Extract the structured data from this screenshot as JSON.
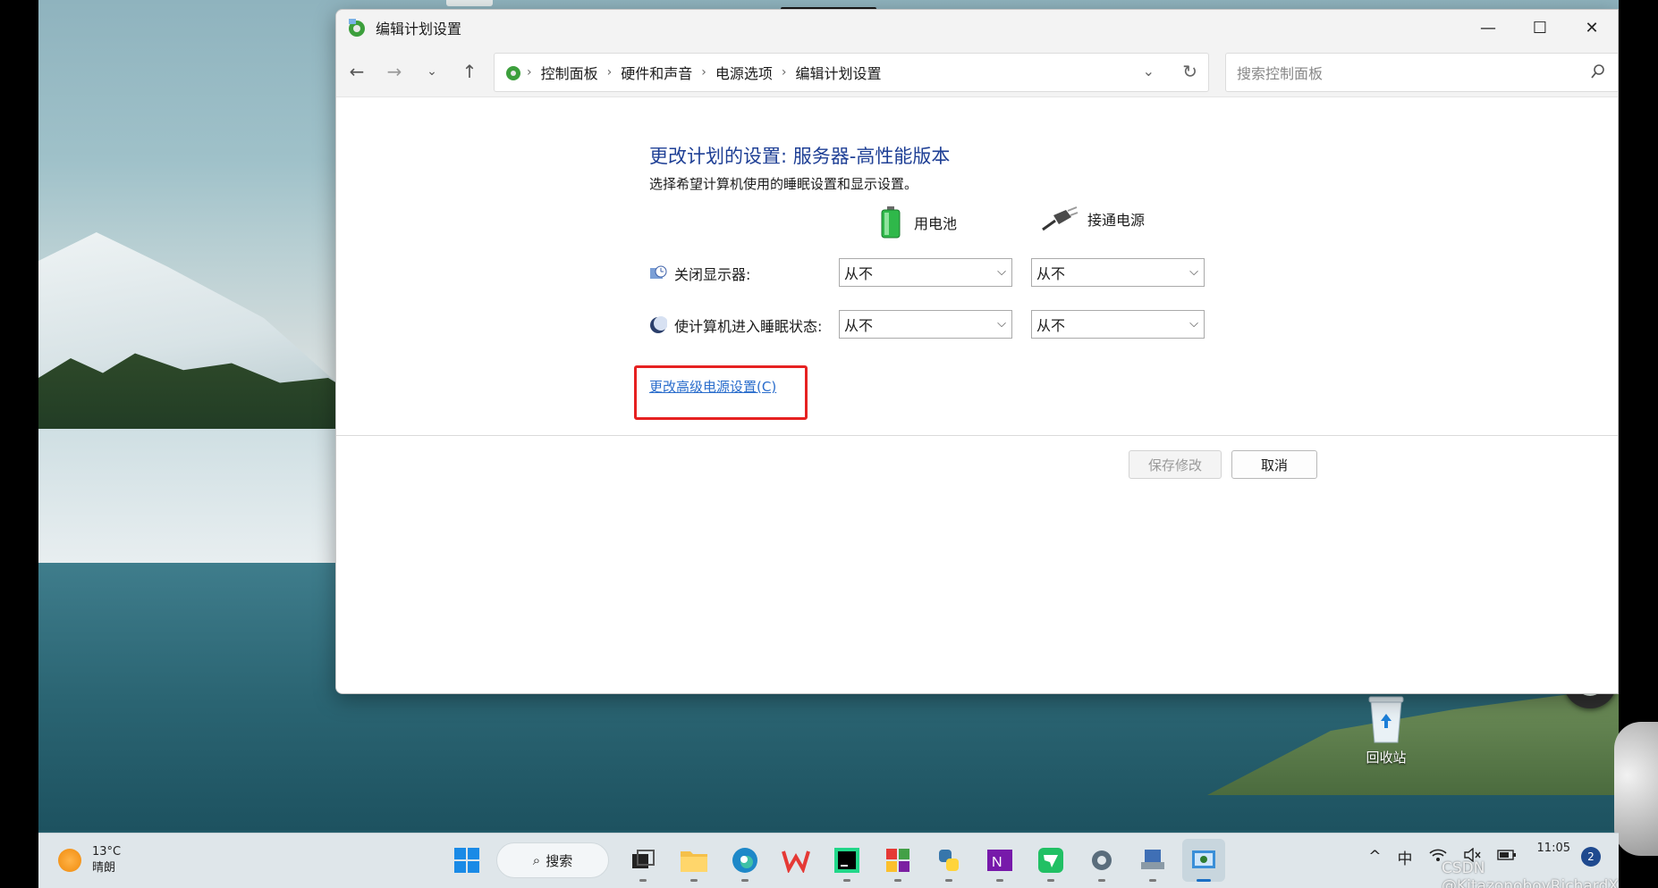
{
  "window": {
    "title": "编辑计划设置",
    "controls": {
      "minimize": "—",
      "maximize": "☐",
      "close": "✕"
    }
  },
  "nav": {
    "back_icon": "back-arrow-icon",
    "breadcrumbs": [
      "控制面板",
      "硬件和声音",
      "电源选项",
      "编辑计划设置"
    ],
    "search_placeholder": "搜索控制面板"
  },
  "main": {
    "heading": "更改计划的设置: 服务器-高性能版本",
    "subheading": "选择希望计算机使用的睡眠设置和显示设置。",
    "columns": {
      "battery": "用电池",
      "plugged": "接通电源"
    },
    "rows": [
      {
        "label": "关闭显示器:",
        "battery": "从不",
        "plugged": "从不"
      },
      {
        "label": "使计算机进入睡眠状态:",
        "battery": "从不",
        "plugged": "从不"
      }
    ],
    "advanced_link": "更改高级电源设置(C)",
    "highlight_color": "#e62121",
    "save_button": "保存修改",
    "cancel_button": "取消"
  },
  "desktop": {
    "recycle_bin": "回收站"
  },
  "taskbar": {
    "temperature": "13°C",
    "weather_desc": "晴朗",
    "search_label": "搜索",
    "ime": "中",
    "time": "11:05",
    "badge_count": "2"
  },
  "watermark": "CSDN @KitazonoboyRichardX"
}
